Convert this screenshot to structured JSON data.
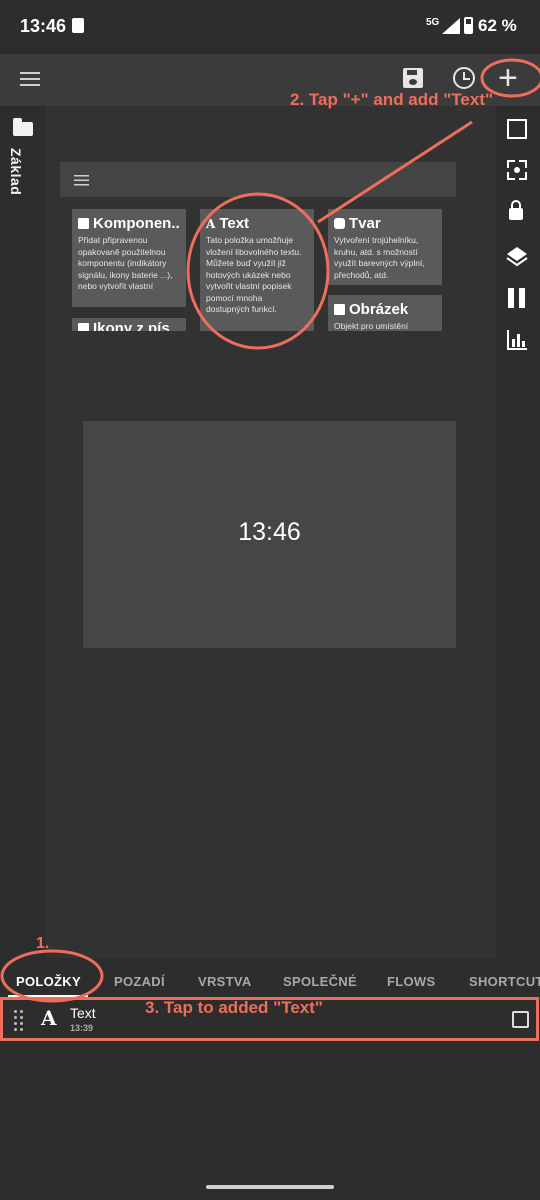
{
  "status_bar": {
    "time": "13:46",
    "network": "5G",
    "battery": "62 %"
  },
  "toolbar": {
    "menu_icon": "menu-icon",
    "save_icon": "save-icon",
    "history_icon": "history-icon",
    "add_icon": "plus-icon",
    "add_glyph": "+"
  },
  "left_rail": {
    "label": "Základ",
    "icon": "folder-icon"
  },
  "right_rail": {
    "icons": [
      "square-icon",
      "focus-icon",
      "lock-icon",
      "layers-icon",
      "pause-icon",
      "chart-icon"
    ]
  },
  "preview": {
    "cards": [
      {
        "title": "Komponen..",
        "text": "Přidat připravenou opakovaně použitelnou komponentu (indikátory signálu, ikony baterie ...), nebo vytvořit vlastní"
      },
      {
        "title": "Text",
        "text": "Tato položka umožňuje vložení libovolného textu. Můžete buď využít již hotových ukázek nebo vytvořit vlastní popisek pomocí mnoha dostupných funkcí."
      },
      {
        "title": "Tvar",
        "text": "Vytvoření trojúhelníku, kruhu, atd. s možností využít barevných výplní, přechodů, atd."
      },
      {
        "title": "Obrázek",
        "text": "Objekt pro umístění"
      },
      {
        "title": "Ikony z pís"
      }
    ],
    "widget_time": "13:46"
  },
  "tabs": [
    {
      "label": "POLOŽKY",
      "active": true
    },
    {
      "label": "POZADÍ"
    },
    {
      "label": "VRSTVA"
    },
    {
      "label": "SPOLEČNÉ"
    },
    {
      "label": "FLOWS"
    },
    {
      "label": "SHORTCUTS"
    }
  ],
  "items": [
    {
      "label": "Text",
      "time": "13:39",
      "type_glyph": "A"
    }
  ],
  "annotations": {
    "step1": "1.",
    "step2": "2. Tap \"+\" and add \"Text\"",
    "step3": "3. Tap to added \"Text\"",
    "color": "#ee6e5c"
  },
  "colors": {
    "background": "#2d2d2d",
    "toolbar": "#3b3b3b",
    "card": "#5a5a5a",
    "accent": "#ee6e5c"
  }
}
